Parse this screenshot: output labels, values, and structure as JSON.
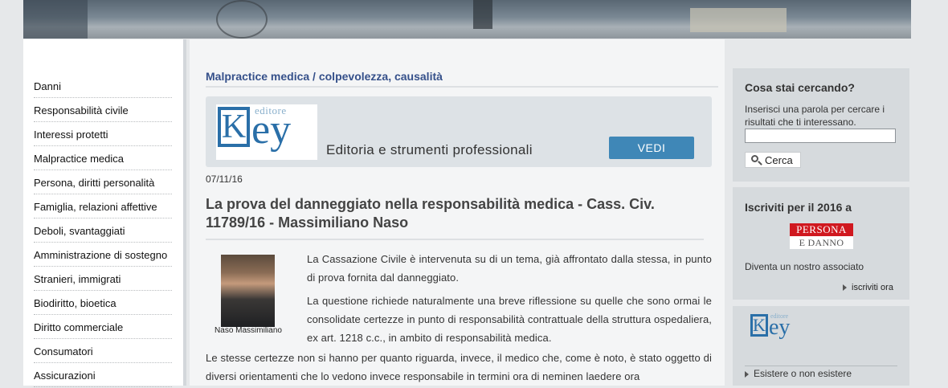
{
  "sidebar": {
    "items": [
      {
        "label": "Danni"
      },
      {
        "label": "Responsabilità civile"
      },
      {
        "label": "Interessi protetti"
      },
      {
        "label": "Malpractice medica"
      },
      {
        "label": "Persona, diritti personalità"
      },
      {
        "label": "Famiglia, relazioni affettive"
      },
      {
        "label": "Deboli, svantaggiati"
      },
      {
        "label": "Amministrazione di sostegno"
      },
      {
        "label": "Stranieri, immigrati"
      },
      {
        "label": "Biodiritto, bioetica"
      },
      {
        "label": "Diritto commerciale"
      },
      {
        "label": "Consumatori"
      },
      {
        "label": "Assicurazioni"
      }
    ]
  },
  "main": {
    "section_title": "Malpractice medica / colpevolezza, causalità",
    "banner": {
      "logo_editore": "editore",
      "logo_k": "K",
      "logo_ey": "ey",
      "tagline": "Editoria e strumenti professionali",
      "button_label": "VEDI"
    },
    "article": {
      "date": "07/11/16",
      "title": "La prova del danneggiato nella responsabilità medica - Cass. Civ. 11789/16 - Massimiliano Naso",
      "author_caption": "Naso Massimiliano",
      "paragraphs": [
        "La Cassazione Civile è intervenuta su di un tema, già affrontato dalla stessa, in punto di prova fornita dal danneggiato.",
        "La questione richiede naturalmente una breve riflessione su quelle che sono ormai le consolidate certezze in punto di responsabilità contrattuale della struttura ospedaliera, ex art. 1218 c.c., in ambito di responsabilità medica.",
        "Le stesse certezze non si hanno per quanto riguarda, invece, il medico che, come è noto, è stato oggetto di diversi orientamenti che lo vedono invece responsabile in termini ora di neminen laedere ora"
      ]
    }
  },
  "right": {
    "search": {
      "title": "Cosa stai cercando?",
      "help": "Inserisci una parola per cercare i risultati che ti interessano.",
      "input_value": "",
      "button_label": "Cerca"
    },
    "subscribe": {
      "title": "Iscriviti per il 2016 a",
      "logo_top": "PERSONA",
      "logo_bottom": "E DANNO",
      "text": "Diventa un nostro associato",
      "link": "iscriviti ora"
    },
    "key_box": {
      "logo_editore": "editore",
      "logo_k": "K",
      "logo_ey": "ey",
      "link": "Esistere o non esistere"
    }
  }
}
